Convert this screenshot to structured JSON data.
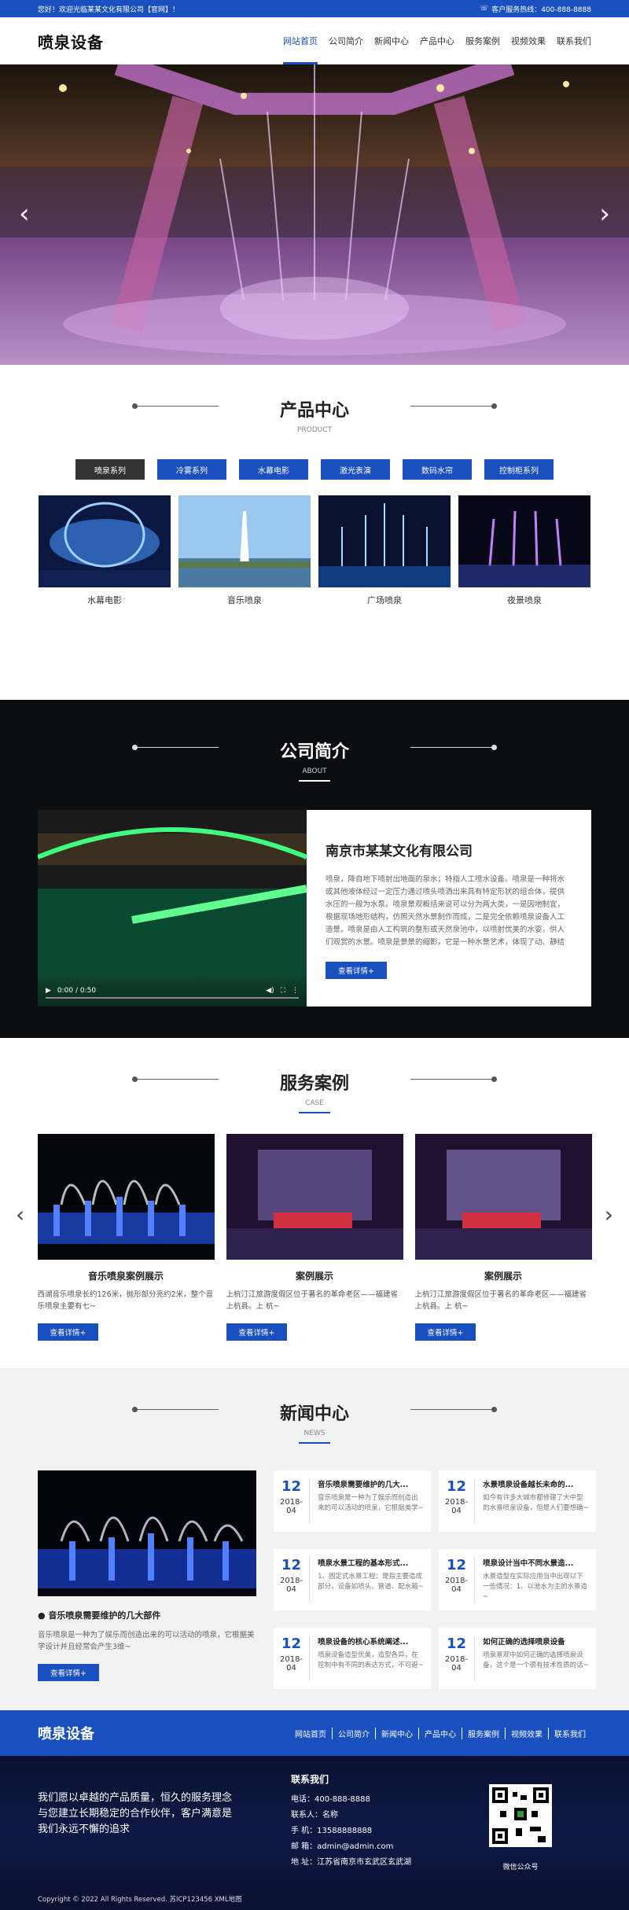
{
  "topbar": {
    "welcome": "您好！欢迎光临某某文化有限公司【官网】！",
    "hotline": "客户服务热线：400-888-8888"
  },
  "header": {
    "logo": "喷泉设备",
    "nav": [
      "网站首页",
      "公司简介",
      "新闻中心",
      "产品中心",
      "服务案例",
      "视频效果",
      "联系我们"
    ]
  },
  "products": {
    "title": "产品中心",
    "subtitle": "PRODUCT",
    "tabs": [
      "喷泉系列",
      "冷雾系列",
      "水幕电影",
      "激光表演",
      "数码水帘",
      "控制柜系列"
    ],
    "items": [
      "水幕电影",
      "音乐喷泉",
      "广场喷泉",
      "夜景喷泉"
    ]
  },
  "about": {
    "title": "公司简介",
    "subtitle": "ABOUT",
    "company": "南京市某某文化有限公司",
    "desc": "喷泉，降自地下喷射出地面的泉水；特指人工喷水设备。喷泉是一种将水或其他液体经过一定压力通过喷头喷洒出来具有特定形状的组合体，提供水压的一般为水泵。喷泉景观概括来说可以分为两大类，一是因地制宜，根据现场地形结构，仿照天然水景制作而成，二是完全依赖喷泉设备人工造景。喷泉是由人工构筑的整形或天然泉池中，以喷射优美的水姿，供人们观赏的水景。喷泉是景景的缩影，它是一种水景艺术，体现了动、静结合，形成明朗活泼...",
    "video_time": "0:00 / 0:50",
    "btn": "查看详情+"
  },
  "cases": {
    "title": "服务案例",
    "subtitle": "CASE",
    "items": [
      {
        "title": "音乐喷泉案例展示",
        "desc": "西湖音乐喷泉长约126米，抛形部分亮约2米，整个音乐喷泉主要有七~",
        "btn": "查看详情+"
      },
      {
        "title": "案例展示",
        "desc": "上杭汀江旅游度假区位于著名的革命老区——福建省上杭县。上 杭~",
        "btn": "查看详情+"
      },
      {
        "title": "案例展示",
        "desc": "上杭汀江旅游度假区位于著名的革命老区——福建省上杭县。上 杭~",
        "btn": "查看详情+"
      }
    ]
  },
  "news": {
    "title": "新闻中心",
    "subtitle": "NEWS",
    "main": {
      "title": "音乐喷泉需要维护的几大部件",
      "desc": "音乐喷泉是一种为了娱乐而创造出来的可以活动的喷泉，它根据美学设计并且经常会产生3维~",
      "btn": "查看详情+"
    },
    "items": [
      {
        "day": "12",
        "month": "2018-04",
        "title": "音乐喷泉需要维护的几大...",
        "desc": "音乐喷泉是一种为了娱乐而创造出来的可以活动的喷泉，它根据美学~"
      },
      {
        "day": "12",
        "month": "2018-04",
        "title": "水景喷泉设备越长未命的...",
        "desc": "如今有许多大城市都修建了大中型的水景喷泉设备，但是人们要想确~"
      },
      {
        "day": "12",
        "month": "2018-04",
        "title": "喷泉水景工程的基本形式...",
        "desc": "1、固定式水景工程：是指主要造成部分，设备如喷头、管道、配水箱~"
      },
      {
        "day": "12",
        "month": "2018-04",
        "title": "喷泉设计当中不同水景造...",
        "desc": "水景造型在实际应用当中出现以下一些情况：1、以池水为主的水景造~"
      },
      {
        "day": "12",
        "month": "2018-04",
        "title": "喷泉设备的核心系统阐述...",
        "desc": "喷泉设备造型优美，造型各异，在控制中有不同的表达方式，不可避~"
      },
      {
        "day": "12",
        "month": "2018-04",
        "title": "如何正确的选择喷泉设备",
        "desc": "喷泉景观中如何正确的选择喷泉设备，这个是一个很有技术性质的话~"
      }
    ]
  },
  "footer": {
    "logo": "喷泉设备",
    "nav": [
      "网站首页",
      "公司简介",
      "新闻中心",
      "产品中心",
      "服务案例",
      "视频效果",
      "联系我们"
    ],
    "slogan": "我们愿以卓越的产品质量，恒久的服务理念与您建立长期稳定的合作伙伴，客户满意是我们永远不懈的追求",
    "contact_title": "联系我们",
    "phone": "电话：400-888-8888",
    "person": "联系人：名称",
    "mobile": "手 机：13588888888",
    "email": "邮 箱：admin@admin.com",
    "address": "地 址：江苏省南京市玄武区玄武湖",
    "qr_caption": "微信公众号",
    "copyright": "Copyright © 2022 All Rights Reserved. 苏ICP123456 XML地图"
  },
  "colors": {
    "primary": "#1a4fc0",
    "dark": "#333333"
  }
}
